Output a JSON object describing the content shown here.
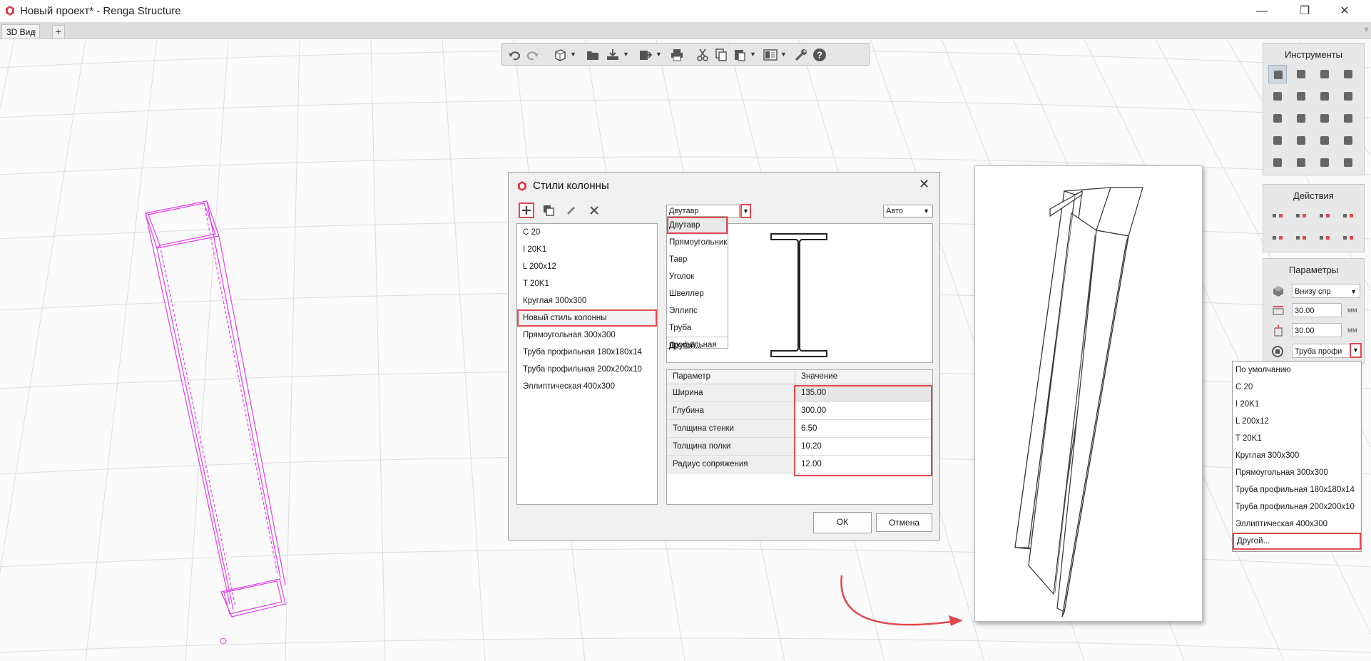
{
  "window": {
    "title": "Новый проект* - Renga Structure",
    "minimize": "—",
    "maximize": "❐",
    "close": "✕"
  },
  "tabs": {
    "active": "3D Вид",
    "close": "×",
    "add": "+",
    "menu": "▿"
  },
  "toolbar": {
    "icons": [
      "undo-icon",
      "redo-icon",
      "view-cube-icon",
      "open-folder-icon",
      "import-icon",
      "export-icon",
      "print-icon",
      "cut-icon",
      "copy-icon",
      "paste-icon",
      "layout-icon",
      "wrench-icon",
      "help-icon"
    ]
  },
  "panels": {
    "tools_title": "Инструменты",
    "actions_title": "Действия",
    "params_title": "Параметры",
    "params": {
      "placement": "Внизу спр",
      "offset1": "30.00",
      "offset2": "30.00",
      "unit": "мм",
      "style": "Труба профи"
    }
  },
  "style_dropdown": {
    "items": [
      "По умолчанию",
      "С 20",
      "I 20K1",
      "L 200x12",
      "T 20K1",
      "Круглая 300x300",
      "Прямоугольная 300x300",
      "Труба профильная 180x180x14",
      "Труба профильная 200x200x10",
      "Эллиптическая 400x300",
      "Другой..."
    ]
  },
  "dialog": {
    "title": "Стили колонны",
    "close": "✕",
    "styles": [
      "С 20",
      "I 20K1",
      "L 200x12",
      "T 20K1",
      "Круглая 300x300",
      "Новый стиль колонны",
      "Прямоугольная 300x300",
      "Труба профильная 180x180x14",
      "Труба профильная 200x200x10",
      "Эллиптическая 400x300"
    ],
    "profile_type": "Двутавр",
    "auto": "Авто",
    "profile_types": [
      "Двутавр",
      "Прямоугольник",
      "Тавр",
      "Уголок",
      "Швеллер",
      "Эллипс",
      "Труба профильная",
      "Другой..."
    ],
    "table": {
      "col_param": "Параметр",
      "col_value": "Значение",
      "rows": [
        {
          "name": "Ширина",
          "value": "135.00"
        },
        {
          "name": "Глубина",
          "value": "300.00"
        },
        {
          "name": "Толщина стенки",
          "value": "6.50"
        },
        {
          "name": "Толщина полки",
          "value": "10.20"
        },
        {
          "name": "Радиус сопряжения",
          "value": "12.00"
        }
      ]
    },
    "ok": "ОК",
    "cancel": "Отмена"
  },
  "colors": {
    "highlight": "#e2484f",
    "wireframe": "#e040e8",
    "grid": "#dcdcdc"
  }
}
